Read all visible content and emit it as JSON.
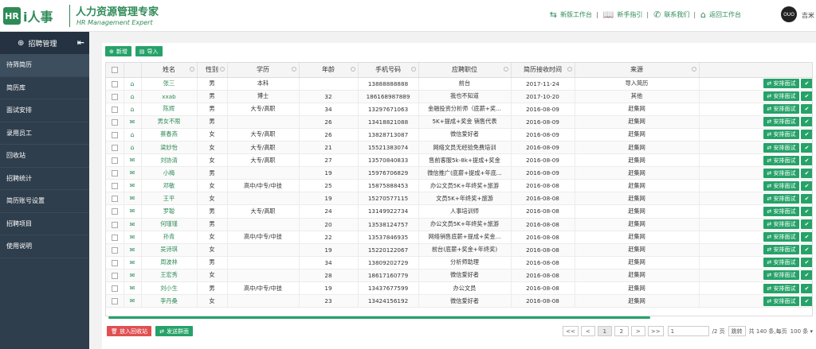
{
  "header": {
    "logo_box": "HR",
    "logo_text": "i人事",
    "title": "人力资源管理专家",
    "subtitle": "HR Management Expert",
    "links": [
      {
        "icon": "switch-arrows-icon",
        "glyph": "⇆",
        "label": "新版工作台"
      },
      {
        "icon": "book-icon",
        "glyph": "📖",
        "label": "新手指引"
      },
      {
        "icon": "phone-icon",
        "glyph": "✆",
        "label": "联系我们"
      },
      {
        "icon": "home-icon",
        "glyph": "⌂",
        "label": "返回工作台"
      }
    ],
    "avatar_text": "OUO",
    "username": "吉米"
  },
  "sidebar": {
    "title": "招聘管理",
    "collapse_glyph": "⇤",
    "items": [
      {
        "label": "待筛简历",
        "active": true
      },
      {
        "label": "简历库",
        "active": false
      },
      {
        "label": "面试安排",
        "active": false
      },
      {
        "label": "录用员工",
        "active": false
      },
      {
        "label": "回收站",
        "active": false
      },
      {
        "label": "招聘统计",
        "active": false
      },
      {
        "label": "简历账号设置",
        "active": false
      },
      {
        "label": "招聘项目",
        "active": false
      },
      {
        "label": "使用说明",
        "active": false
      }
    ]
  },
  "toolbar": {
    "add_label": "新增",
    "import_label": "导入"
  },
  "table": {
    "headers": [
      "姓名",
      "性别",
      "学历",
      "年龄",
      "手机号码",
      "应聘职位",
      "简历接收时间",
      "来源"
    ],
    "action_label": "安排面试",
    "rows": [
      {
        "status": "person",
        "name": "张三",
        "gender": "男",
        "edu": "本科",
        "age": "",
        "phone": "13888888888",
        "position": "前台",
        "date": "2017-11-24",
        "source": "导入简历"
      },
      {
        "status": "person",
        "name": "xxab",
        "gender": "男",
        "edu": "博士",
        "age": "32",
        "phone": "186168987889",
        "position": "我也不知道",
        "date": "2017-10-20",
        "source": "其他"
      },
      {
        "status": "person",
        "name": "陈辉",
        "gender": "男",
        "edu": "大专/高职",
        "age": "34",
        "phone": "13297671063",
        "position": "金融投资分析师（底薪+奖...",
        "date": "2016-08-09",
        "source": "赶集网"
      },
      {
        "status": "mail",
        "name": "男女不限",
        "gender": "男",
        "edu": "",
        "age": "26",
        "phone": "13418821088",
        "position": "5K+提成+奖金 销售代表",
        "date": "2016-08-09",
        "source": "赶集网"
      },
      {
        "status": "person",
        "name": "蔡春燕",
        "gender": "女",
        "edu": "大专/高职",
        "age": "26",
        "phone": "13828713087",
        "position": "微信爱好者",
        "date": "2016-08-09",
        "source": "赶集网"
      },
      {
        "status": "person",
        "name": "梁妙怡",
        "gender": "女",
        "edu": "大专/高职",
        "age": "21",
        "phone": "15521383074",
        "position": "网络文员无经验免费培训",
        "date": "2016-08-09",
        "source": "赶集网"
      },
      {
        "status": "mail",
        "name": "刘协清",
        "gender": "女",
        "edu": "大专/高职",
        "age": "27",
        "phone": "13570840833",
        "position": "售前客服5k-8k+提成+奖金",
        "date": "2016-08-09",
        "source": "赶集网"
      },
      {
        "status": "mail",
        "name": "小梅",
        "gender": "男",
        "edu": "",
        "age": "19",
        "phone": "15976706829",
        "position": "微信推广(底薪+提成+年底...",
        "date": "2016-08-09",
        "source": "赶集网"
      },
      {
        "status": "mail",
        "name": "邓敏",
        "gender": "女",
        "edu": "高中/中专/中技",
        "age": "25",
        "phone": "15875888453",
        "position": "办公文员5K+年终奖+旅游",
        "date": "2016-08-08",
        "source": "赶集网"
      },
      {
        "status": "mail",
        "name": "王平",
        "gender": "女",
        "edu": "",
        "age": "19",
        "phone": "15270577115",
        "position": "文员5K+年终奖+旅游",
        "date": "2016-08-08",
        "source": "赶集网"
      },
      {
        "status": "mail",
        "name": "罗聪",
        "gender": "男",
        "edu": "大专/高职",
        "age": "24",
        "phone": "13149922734",
        "position": "人事培训师",
        "date": "2016-08-08",
        "source": "赶集网"
      },
      {
        "status": "mail",
        "name": "何瑾瑾",
        "gender": "男",
        "edu": "",
        "age": "20",
        "phone": "13538124757",
        "position": "办公文员5K+年终奖+旅游",
        "date": "2016-08-08",
        "source": "赶集网"
      },
      {
        "status": "mail",
        "name": "孙青",
        "gender": "女",
        "edu": "高中/中专/中技",
        "age": "22",
        "phone": "13537846935",
        "position": "网络销售底薪+提成+奖金...",
        "date": "2016-08-08",
        "source": "赶集网"
      },
      {
        "status": "mail",
        "name": "吴诗琪",
        "gender": "女",
        "edu": "",
        "age": "19",
        "phone": "15220122067",
        "position": "前台(底薪+奖金+年终奖)",
        "date": "2016-08-08",
        "source": "赶集网"
      },
      {
        "status": "mail",
        "name": "周波林",
        "gender": "男",
        "edu": "",
        "age": "34",
        "phone": "13809202729",
        "position": "分析师助理",
        "date": "2016-08-08",
        "source": "赶集网"
      },
      {
        "status": "mail",
        "name": "王宏秀",
        "gender": "女",
        "edu": "",
        "age": "28",
        "phone": "18617160779",
        "position": "微信爱好者",
        "date": "2016-08-08",
        "source": "赶集网"
      },
      {
        "status": "mail",
        "name": "刘小生",
        "gender": "男",
        "edu": "高中/中专/中技",
        "age": "19",
        "phone": "13437677599",
        "position": "办公文员",
        "date": "2016-08-08",
        "source": "赶集网"
      },
      {
        "status": "mail",
        "name": "李丹桑",
        "gender": "女",
        "edu": "",
        "age": "23",
        "phone": "13424156192",
        "position": "微信爱好者",
        "date": "2016-08-08",
        "source": "赶集网"
      }
    ]
  },
  "bottom": {
    "recycle_label": "放入回收站",
    "group_send_label": "发送群面"
  },
  "pager": {
    "first": "<<",
    "prev": "<",
    "pages": [
      "1",
      "2"
    ],
    "current": "2",
    "next": ">",
    "last": ">>",
    "page_input": "1",
    "total_pages": "/2 页",
    "go": "跳转",
    "total_text": "共 140 条,每页",
    "per_page": "100 条 ▾"
  },
  "colors": {
    "brand": "#2e8b57",
    "sidebar": "#2f3e4c",
    "button": "#26a269",
    "danger": "#e05050"
  }
}
